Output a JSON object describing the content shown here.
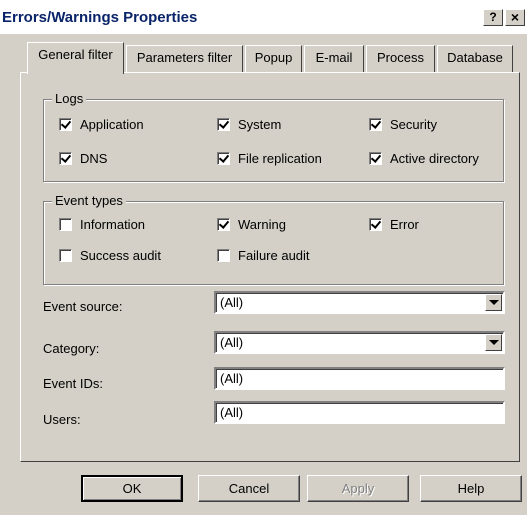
{
  "window": {
    "title": "Errors/Warnings Properties",
    "help_glyph": "?",
    "close_glyph": "×"
  },
  "tabs": [
    {
      "label": "General filter",
      "active": true
    },
    {
      "label": "Parameters filter"
    },
    {
      "label": "Popup"
    },
    {
      "label": "E-mail"
    },
    {
      "label": "Process"
    },
    {
      "label": "Database"
    }
  ],
  "logs": {
    "label": "Logs",
    "items": [
      {
        "label": "Application",
        "checked": true
      },
      {
        "label": "System",
        "checked": true
      },
      {
        "label": "Security",
        "checked": true
      },
      {
        "label": "DNS",
        "checked": true
      },
      {
        "label": "File replication",
        "checked": true
      },
      {
        "label": "Active directory",
        "checked": true
      }
    ]
  },
  "event_types": {
    "label": "Event types",
    "items": [
      {
        "label": "Information",
        "checked": false
      },
      {
        "label": "Warning",
        "checked": true
      },
      {
        "label": "Error",
        "checked": true
      },
      {
        "label": "Success audit",
        "checked": false
      },
      {
        "label": "Failure audit",
        "checked": false
      }
    ]
  },
  "fields": {
    "event_source": {
      "label": "Event source:",
      "value": "(All)"
    },
    "category": {
      "label": "Category:",
      "value": "(All)"
    },
    "event_ids": {
      "label": "Event IDs:",
      "value": "(All)"
    },
    "users": {
      "label": "Users:",
      "value": "(All)"
    }
  },
  "buttons": {
    "ok": "OK",
    "cancel": "Cancel",
    "apply": "Apply",
    "help": "Help"
  }
}
